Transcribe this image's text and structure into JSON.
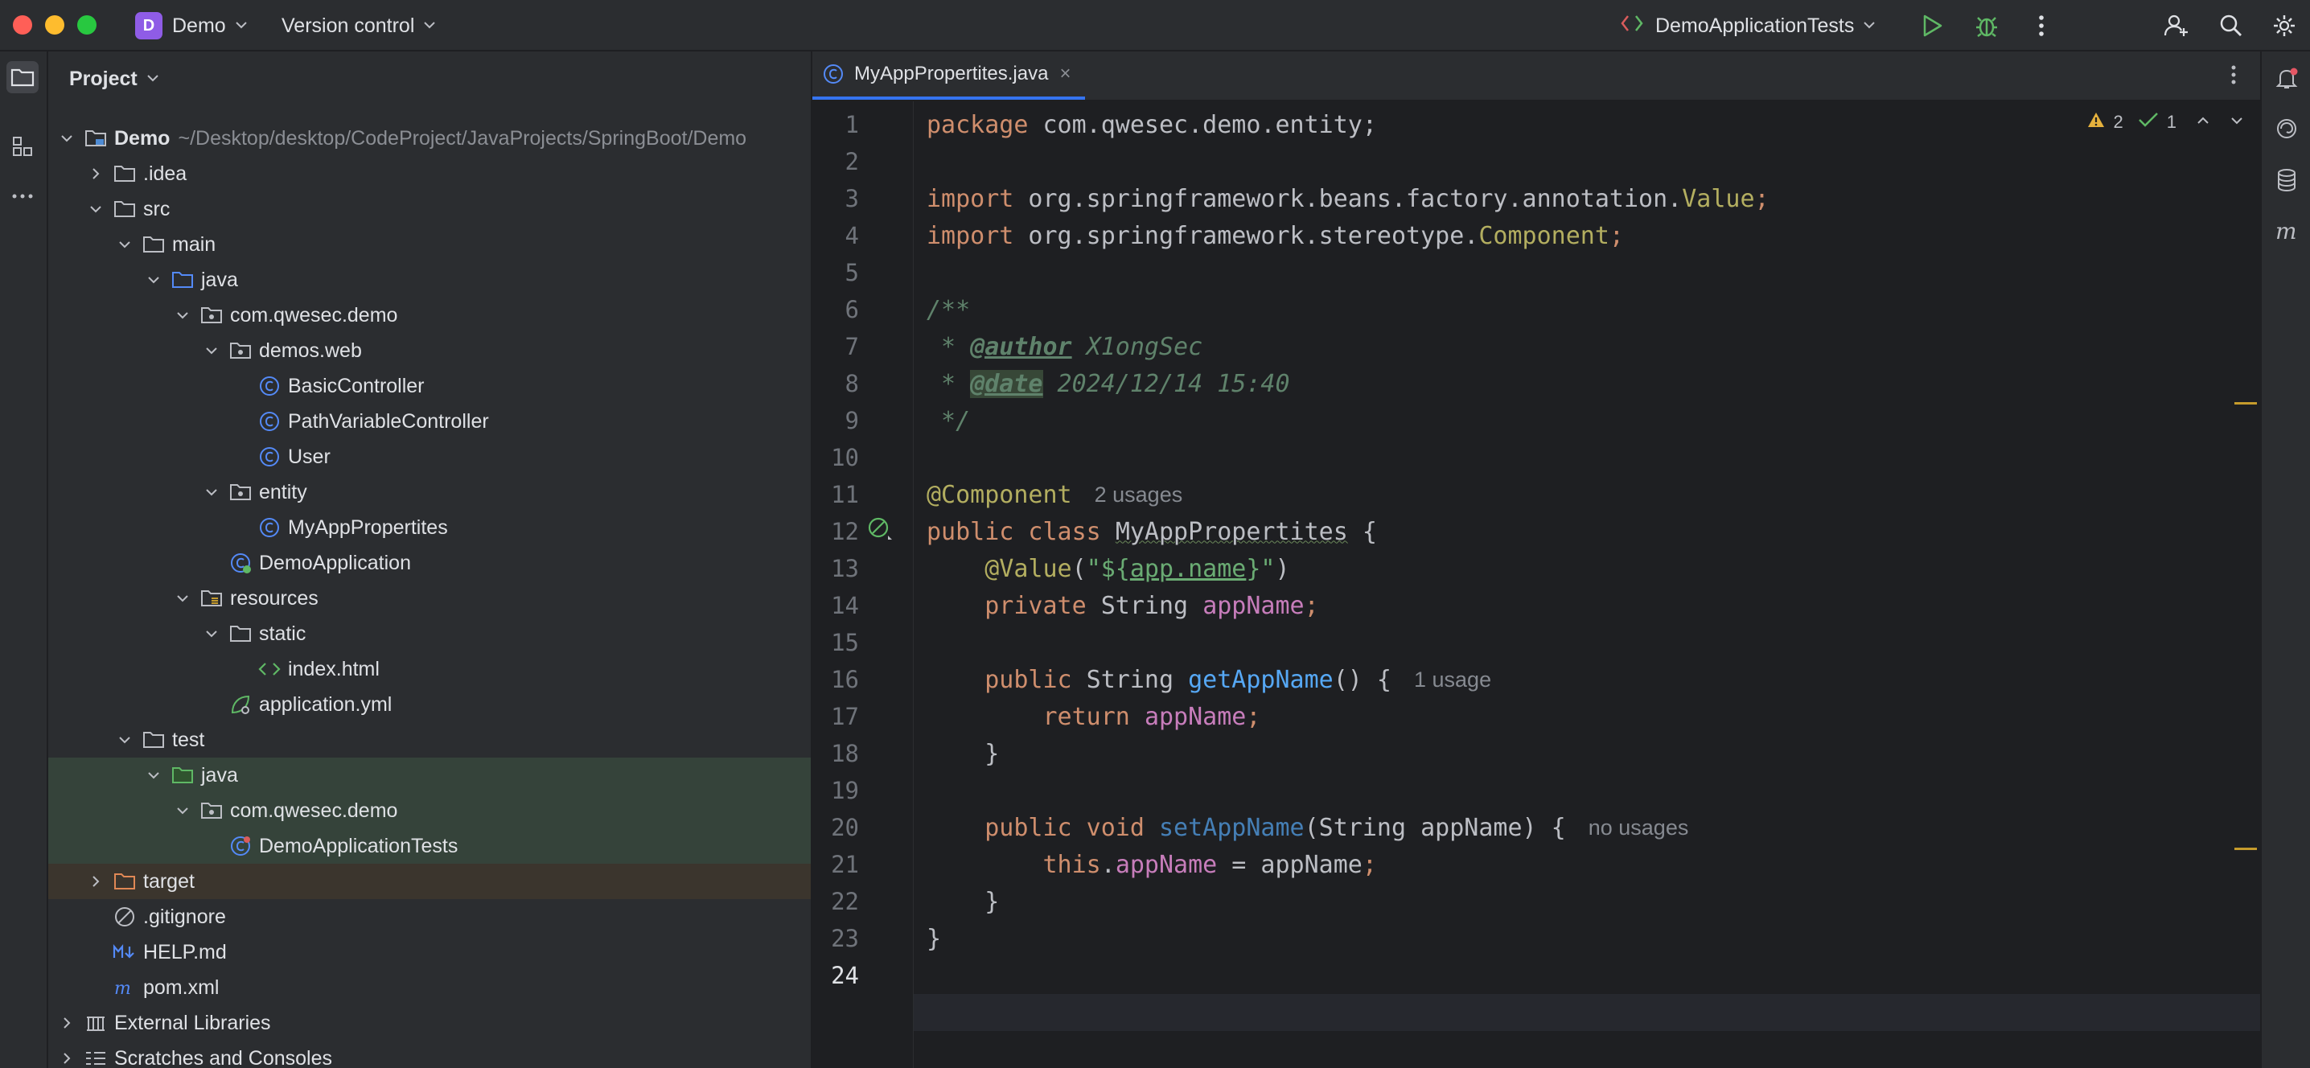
{
  "titlebar": {
    "project_badge": "D",
    "project_name": "Demo",
    "vcs_label": "Version control",
    "run_config": "DemoApplicationTests"
  },
  "project_panel": {
    "title": "Project",
    "tree": [
      {
        "label": "Demo",
        "path": "~/Desktop/desktop/CodeProject/JavaProjects/SpringBoot/Demo"
      },
      {
        "label": ".idea"
      },
      {
        "label": "src"
      },
      {
        "label": "main"
      },
      {
        "label": "java"
      },
      {
        "label": "com.qwesec.demo"
      },
      {
        "label": "demos.web"
      },
      {
        "label": "BasicController"
      },
      {
        "label": "PathVariableController"
      },
      {
        "label": "User"
      },
      {
        "label": "entity"
      },
      {
        "label": "MyAppPropertites"
      },
      {
        "label": "DemoApplication"
      },
      {
        "label": "resources"
      },
      {
        "label": "static"
      },
      {
        "label": "index.html"
      },
      {
        "label": "application.yml"
      },
      {
        "label": "test"
      },
      {
        "label": "java"
      },
      {
        "label": "com.qwesec.demo"
      },
      {
        "label": "DemoApplicationTests"
      },
      {
        "label": "target"
      },
      {
        "label": ".gitignore"
      },
      {
        "label": "HELP.md"
      },
      {
        "label": "pom.xml"
      },
      {
        "label": "External Libraries"
      },
      {
        "label": "Scratches and Consoles"
      }
    ]
  },
  "editor": {
    "tab_label": "MyAppPropertites.java",
    "tab_close": "×",
    "warnings": "2",
    "checks": "1",
    "line_numbers": [
      "1",
      "2",
      "3",
      "4",
      "5",
      "6",
      "7",
      "8",
      "9",
      "10",
      "11",
      "12",
      "13",
      "14",
      "15",
      "16",
      "17",
      "18",
      "19",
      "20",
      "21",
      "22",
      "23",
      "24"
    ],
    "code": {
      "l1_kw": "package",
      "l1_rest": " com.qwesec.demo.entity;",
      "l3_kw": "import",
      "l3_rest": " org.springframework.beans.factory.annotation.",
      "l3_cls": "Value",
      "l3_end": ";",
      "l4_kw": "import",
      "l4_rest": " org.springframework.stereotype.",
      "l4_cls": "Component",
      "l4_end": ";",
      "l6": "/**",
      "l7_pre": " * ",
      "l7_tag": "@author",
      "l7_val": " X1ongSec",
      "l8_pre": " * ",
      "l8_tag": "@date",
      "l8_val": " 2024/12/14 15:40",
      "l9": " */",
      "l11_ann": "@Component",
      "l11_hint": "2 usages",
      "l12_kw": "public class ",
      "l12_name": "MyAppPropertites",
      "l12_end": " {",
      "l13_indent": "    ",
      "l13_ann": "@Value",
      "l13_p1": "(",
      "l13_q1": "\"${",
      "l13_val": "app.name",
      "l13_q2": "}\"",
      "l13_p2": ")",
      "l14_indent": "    ",
      "l14_kw": "private",
      "l14_type": " String ",
      "l14_fld": "appName",
      "l14_end": ";",
      "l16_indent": "    ",
      "l16_kw": "public",
      "l16_type": " String ",
      "l16_mth": "getAppName",
      "l16_end": "() {",
      "l16_hint": "1 usage",
      "l17_indent": "        ",
      "l17_kw": "return ",
      "l17_fld": "appName",
      "l17_end": ";",
      "l18": "    }",
      "l20_indent": "    ",
      "l20_kw": "public void ",
      "l20_mth": "setAppName",
      "l20_rest": "(String appName) {",
      "l20_hint": "no usages",
      "l21_indent": "        ",
      "l21_kw": "this",
      "l21_dot": ".",
      "l21_fld": "appName",
      "l21_rest": " = appName",
      "l21_end": ";",
      "l22": "    }",
      "l23": "}"
    }
  },
  "colors": {
    "background": "#1e1f22",
    "panel": "#2b2d30",
    "keyword": "#cf8e6d",
    "annotation": "#b3ae60",
    "field": "#c77dbb",
    "method": "#56a8f5",
    "string": "#6aab73",
    "comment": "#5f826b",
    "selection": "#11263e",
    "accent": "#3574f0"
  }
}
